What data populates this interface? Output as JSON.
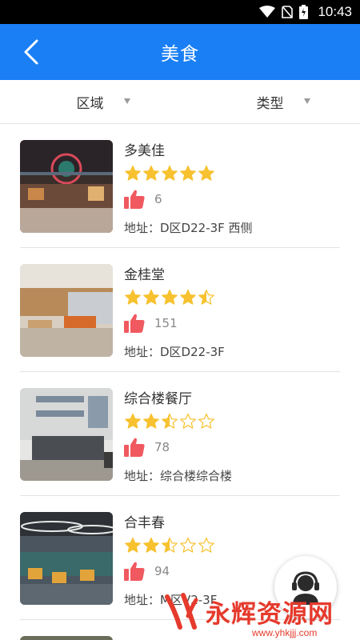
{
  "status_bar": {
    "time": "10:43",
    "icons": [
      "wifi-icon",
      "no-sim-icon",
      "battery-icon"
    ]
  },
  "app_bar": {
    "title": "美食",
    "back_icon": "chevron-left-icon",
    "color": "#1a7ff5"
  },
  "filters": [
    {
      "label": "区域"
    },
    {
      "label": "类型"
    }
  ],
  "restaurants": [
    {
      "name": "多美佳",
      "rating": 5,
      "likes": "6",
      "address": "地址：D区D22-3F 西侧"
    },
    {
      "name": "金桂堂",
      "rating": 4.5,
      "likes": "151",
      "address": "地址：D区D22-3F"
    },
    {
      "name": "综合楼餐厅",
      "rating": 2.5,
      "likes": "78",
      "address": "地址：综合楼综合楼"
    },
    {
      "name": "合丰春",
      "rating": 2.5,
      "likes": "94",
      "address": "地址：M区V2-3F"
    }
  ],
  "partial_item": {
    "name": ""
  },
  "customer_service": {
    "icon": "customer-service-icon"
  },
  "watermark": {
    "text": "永辉资源网",
    "url": "www.yhkjjj.com"
  },
  "colors": {
    "star": "#f7c12f",
    "like": "#f0595f",
    "accent": "#1a7ff5"
  }
}
